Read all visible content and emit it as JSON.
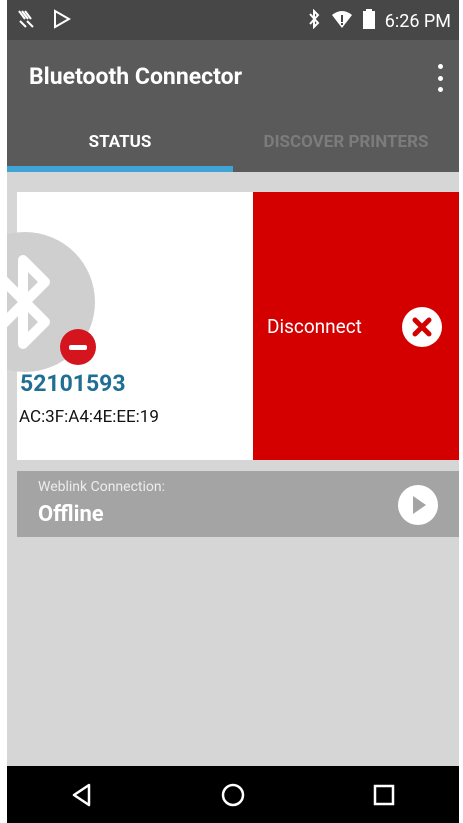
{
  "status_bar": {
    "time": "6:26 PM",
    "icons": [
      "zebra-icon",
      "play-store-icon",
      "bluetooth-icon",
      "wifi-icon",
      "battery-icon"
    ]
  },
  "app": {
    "title": "Bluetooth Connector",
    "tabs": [
      {
        "label": "STATUS",
        "selected": true
      },
      {
        "label": "DISCOVER PRINTERS",
        "selected": false
      }
    ]
  },
  "printer": {
    "id": "52101593",
    "mac": "AC:3F:A4:4E:EE:19",
    "disconnect_label": "Disconnect"
  },
  "weblink": {
    "label": "Weblink Connection:",
    "status": "Offline"
  },
  "nav": {
    "icons": [
      "back-icon",
      "home-icon",
      "recents-icon"
    ]
  },
  "colors": {
    "accent": "#41a4d6",
    "danger": "#d40000",
    "printer_id": "#1f6e94"
  }
}
